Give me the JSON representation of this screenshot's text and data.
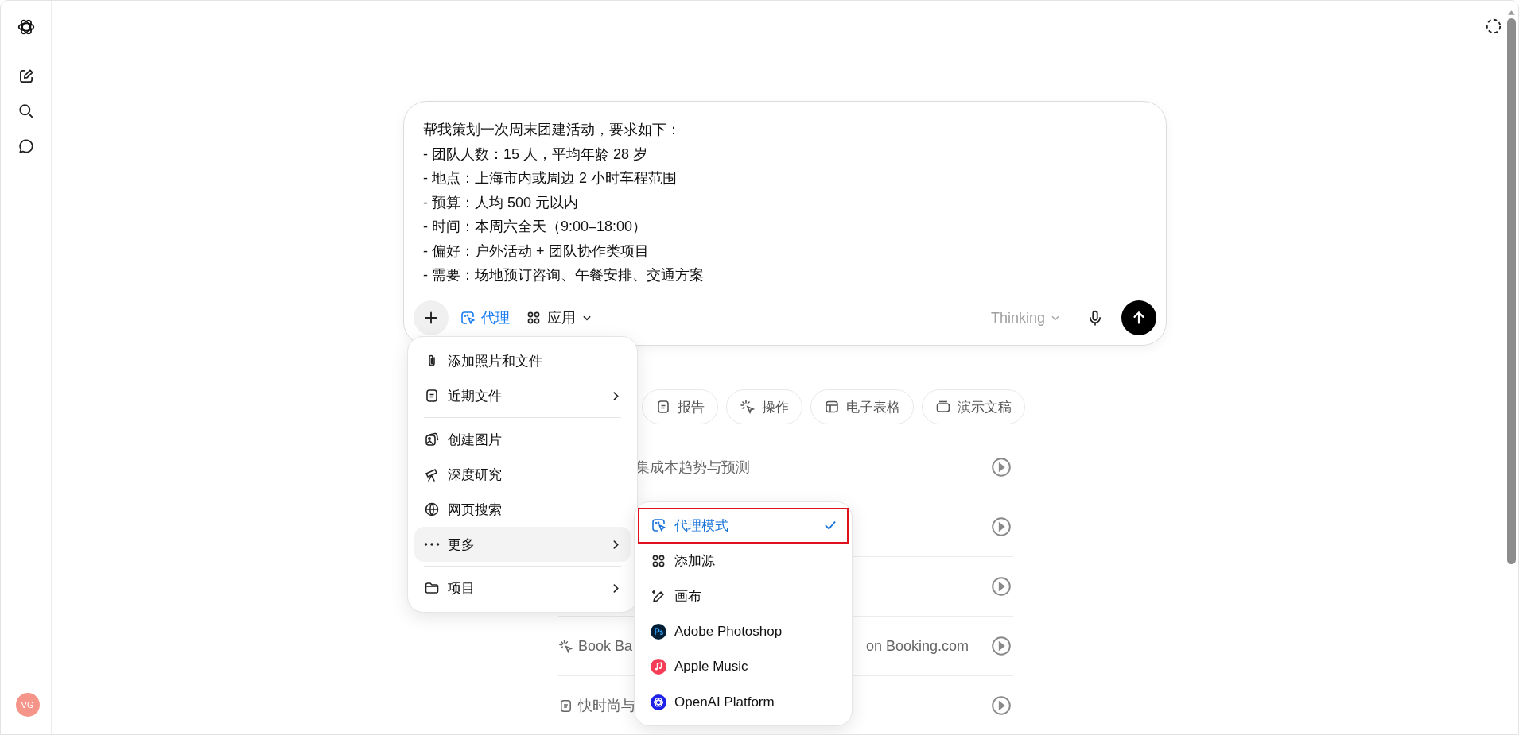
{
  "sidebar": {
    "avatar": "VG"
  },
  "composer": {
    "lines": [
      "帮我策划一次周末团建活动，要求如下：",
      "- 团队人数：15 人，平均年龄 28 岁",
      "- 地点：上海市内或周边 2 小时车程范围",
      "- 预算：人均 500 元以内",
      "- 时间：本周六全天（9:00–18:00）",
      "- 偏好：户外活动 + 团队协作类项目",
      "- 需要：场地预订咨询、午餐安排、交通方案"
    ],
    "agent_label": "代理",
    "agent_active": true,
    "apps_label": "应用",
    "model": "Thinking"
  },
  "chips": [
    {
      "label": "报告"
    },
    {
      "label": "操作"
    },
    {
      "label": "电子表格"
    },
    {
      "label": "演示文稿"
    }
  ],
  "suggestions": [
    {
      "kind": "text",
      "text": "集成本趋势与预测"
    },
    {
      "kind": "covered"
    },
    {
      "kind": "covered"
    },
    {
      "kind": "split",
      "text": "Book Ba",
      "text_end": "on Booking.com"
    },
    {
      "kind": "icon_text",
      "text": "快时尚与"
    }
  ],
  "attach_menu": {
    "items": [
      {
        "kind": "item",
        "label": "添加照片和文件",
        "selected": false
      },
      {
        "kind": "submenu",
        "label": "近期文件",
        "selected": false
      },
      {
        "kind": "divider"
      },
      {
        "kind": "item",
        "label": "创建图片",
        "selected": false
      },
      {
        "kind": "item",
        "label": "深度研究",
        "selected": false
      },
      {
        "kind": "item",
        "label": "网页搜索",
        "selected": false
      },
      {
        "kind": "submenu",
        "label": "更多",
        "selected": true
      },
      {
        "kind": "divider"
      },
      {
        "kind": "submenu",
        "label": "项目",
        "selected": false
      }
    ]
  },
  "more_menu": {
    "items": [
      {
        "label": "代理模式",
        "selected": true
      },
      {
        "label": "添加源",
        "selected": false
      },
      {
        "label": "画布",
        "selected": false
      },
      {
        "label": "Adobe Photoshop",
        "selected": false
      },
      {
        "label": "Apple Music",
        "selected": false
      },
      {
        "label": "OpenAI Platform",
        "selected": false
      }
    ]
  }
}
